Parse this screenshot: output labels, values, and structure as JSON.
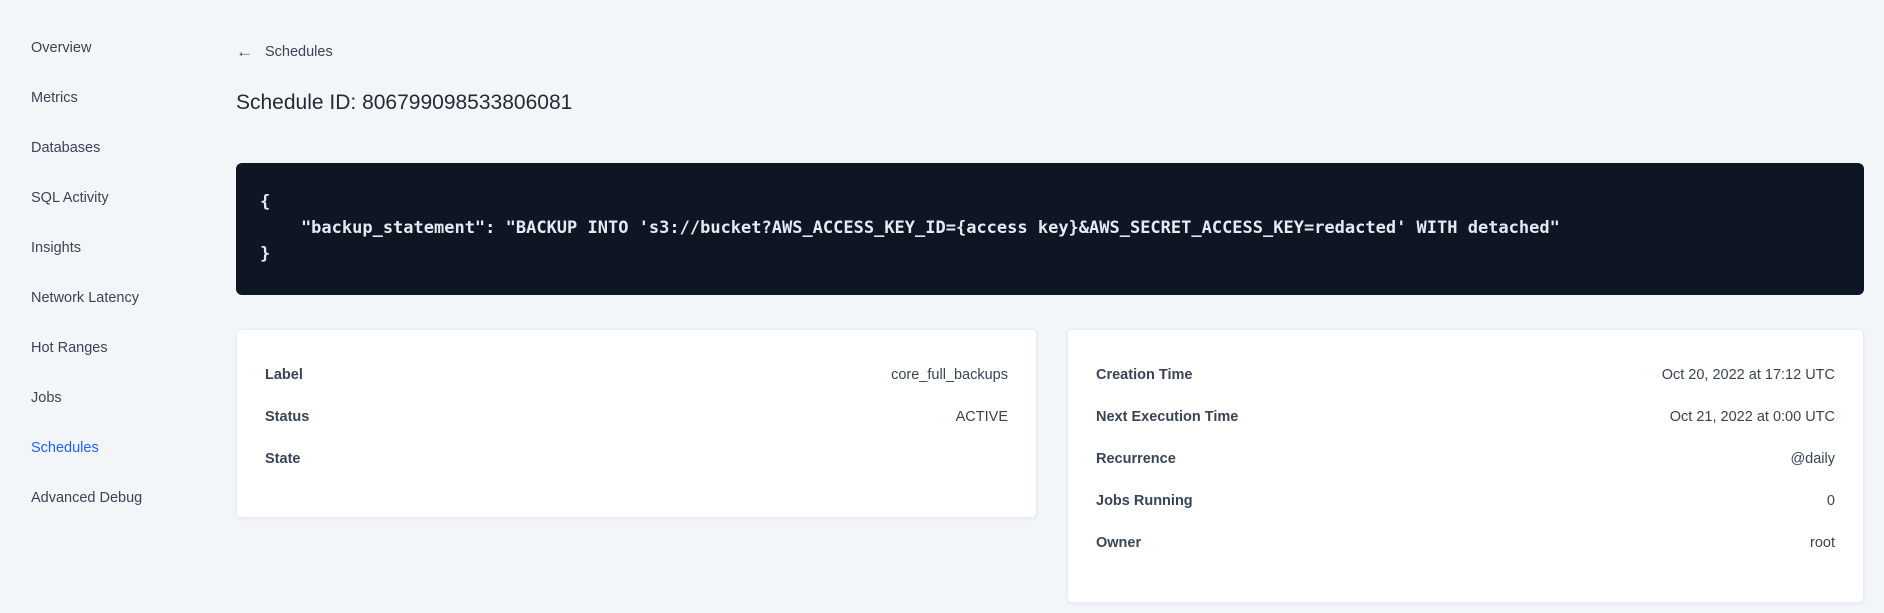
{
  "sidebar": {
    "items": [
      {
        "label": "Overview",
        "active": false
      },
      {
        "label": "Metrics",
        "active": false
      },
      {
        "label": "Databases",
        "active": false
      },
      {
        "label": "SQL Activity",
        "active": false
      },
      {
        "label": "Insights",
        "active": false
      },
      {
        "label": "Network Latency",
        "active": false
      },
      {
        "label": "Hot Ranges",
        "active": false
      },
      {
        "label": "Jobs",
        "active": false
      },
      {
        "label": "Schedules",
        "active": true
      },
      {
        "label": "Advanced Debug",
        "active": false
      }
    ]
  },
  "header": {
    "back_label": "Schedules",
    "back_icon": "arrow-left",
    "title": "Schedule ID: 806799098533806081"
  },
  "code_block": {
    "lines": [
      "{",
      "    \"backup_statement\": \"BACKUP INTO 's3://bucket?AWS_ACCESS_KEY_ID={access key}&AWS_SECRET_ACCESS_KEY=redacted' WITH detached\"",
      "}"
    ]
  },
  "details_card": {
    "rows": [
      {
        "label": "Label",
        "value": "core_full_backups"
      },
      {
        "label": "Status",
        "value": "ACTIVE"
      },
      {
        "label": "State",
        "value": ""
      }
    ]
  },
  "schedule_card": {
    "rows": [
      {
        "label": "Creation Time",
        "value": "Oct 20, 2022 at 17:12 UTC"
      },
      {
        "label": "Next Execution Time",
        "value": "Oct 21, 2022 at 0:00 UTC"
      },
      {
        "label": "Recurrence",
        "value": "@daily"
      },
      {
        "label": "Jobs Running",
        "value": "0"
      },
      {
        "label": "Owner",
        "value": "root"
      }
    ]
  },
  "colors": {
    "background": "#f3f6f9",
    "text_primary": "#394455",
    "title": "#242a35",
    "active_link": "#1f5eff",
    "code_background": "#0e1624",
    "code_text": "#e5eaf2",
    "card_background": "#ffffff",
    "card_border": "#e7ecf3"
  }
}
